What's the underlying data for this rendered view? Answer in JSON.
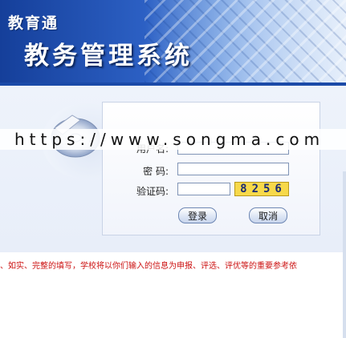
{
  "header": {
    "brand": "教育通",
    "system_title": "教务管理系统"
  },
  "watermark": {
    "text": "https://www.songma.com"
  },
  "login": {
    "username_label": "用户名:",
    "password_label": "密  码:",
    "captcha_label": "验证码:",
    "username_value": "",
    "password_value": "",
    "captcha_value": "",
    "captcha_code": "8256",
    "login_button": "登录",
    "cancel_button": "取消"
  },
  "notice": {
    "text": "、如实、完整的填写，学校将以你们输入的信息为申报、评选、评优等的重要参考依"
  },
  "colors": {
    "banner_dark": "#153f9a",
    "banner_light": "#9ec0ee",
    "captcha_bg": "#f7d94a",
    "notice_text": "#cc1111"
  }
}
